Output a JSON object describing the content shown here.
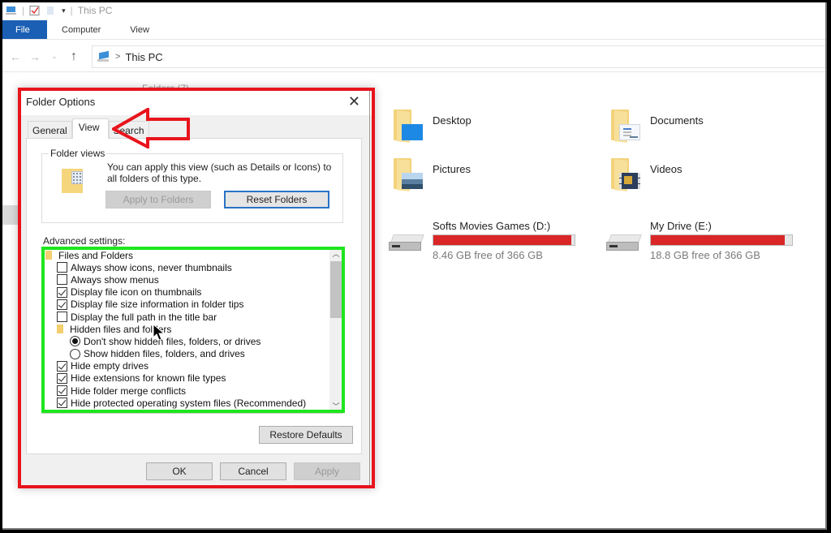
{
  "window": {
    "title": "This PC",
    "quick_access_icons": [
      "computer-icon",
      "properties-checkbox-icon",
      "new-folder-icon",
      "customize-dropdown-icon"
    ]
  },
  "ribbon": {
    "tabs": [
      {
        "label": "File",
        "active": true
      },
      {
        "label": "Computer",
        "active": false
      },
      {
        "label": "View",
        "active": false
      }
    ]
  },
  "navigation": {
    "back_icon": "back-arrow-icon",
    "forward_icon": "forward-arrow-icon",
    "recent_icon": "chevron-down-icon",
    "up_icon": "up-arrow-icon",
    "address": {
      "root_icon": "this-pc-icon",
      "separator": ">",
      "path": "This PC"
    }
  },
  "content": {
    "folders_header": "Folders (7)",
    "folders": [
      {
        "name": "Desktop",
        "icon": "desktop-folder-icon"
      },
      {
        "name": "Documents",
        "icon": "documents-folder-icon"
      },
      {
        "name": "Pictures",
        "icon": "pictures-folder-icon"
      },
      {
        "name": "Videos",
        "icon": "videos-folder-icon"
      }
    ],
    "drives": [
      {
        "name": "Softs Movies Games (D:)",
        "free_text": "8.46 GB free of 366 GB",
        "used_fraction": 0.977,
        "bar_color": "#da2626"
      },
      {
        "name": "My Drive (E:)",
        "free_text": "18.8 GB free of 366 GB",
        "used_fraction": 0.949,
        "bar_color": "#da2626"
      }
    ]
  },
  "dialog": {
    "title": "Folder Options",
    "close_icon": "close-icon",
    "tabs": [
      {
        "label": "General",
        "active": false
      },
      {
        "label": "View",
        "active": true
      },
      {
        "label": "Search",
        "active": false
      }
    ],
    "folder_views": {
      "legend": "Folder views",
      "description": "You can apply this view (such as Details or Icons) to all folders of this type.",
      "apply_button": "Apply to Folders",
      "reset_button": "Reset Folders"
    },
    "advanced_label": "Advanced settings:",
    "advanced_items": [
      {
        "type": "folder",
        "level": 0,
        "label": "Files and Folders"
      },
      {
        "type": "checkbox",
        "level": 1,
        "label": "Always show icons, never thumbnails",
        "checked": false
      },
      {
        "type": "checkbox",
        "level": 1,
        "label": "Always show menus",
        "checked": false
      },
      {
        "type": "checkbox",
        "level": 1,
        "label": "Display file icon on thumbnails",
        "checked": true
      },
      {
        "type": "checkbox",
        "level": 1,
        "label": "Display file size information in folder tips",
        "checked": true
      },
      {
        "type": "checkbox",
        "level": 1,
        "label": "Display the full path in the title bar",
        "checked": false
      },
      {
        "type": "folder",
        "level": 1,
        "label": "Hidden files and folders"
      },
      {
        "type": "radio",
        "level": 2,
        "label": "Don't show hidden files, folders, or drives",
        "checked": true
      },
      {
        "type": "radio",
        "level": 2,
        "label": "Show hidden files, folders, and drives",
        "checked": false
      },
      {
        "type": "checkbox",
        "level": 1,
        "label": "Hide empty drives",
        "checked": true
      },
      {
        "type": "checkbox",
        "level": 1,
        "label": "Hide extensions for known file types",
        "checked": true
      },
      {
        "type": "checkbox",
        "level": 1,
        "label": "Hide folder merge conflicts",
        "checked": true
      },
      {
        "type": "checkbox",
        "level": 1,
        "label": "Hide protected operating system files (Recommended)",
        "checked": true
      }
    ],
    "restore_button": "Restore Defaults",
    "ok_button": "OK",
    "cancel_button": "Cancel",
    "apply_button": "Apply"
  },
  "annotations": {
    "dialog_highlight_color": "#e8141c",
    "list_highlight_color": "#1ee61e",
    "arrow_color": "#e8141c"
  }
}
